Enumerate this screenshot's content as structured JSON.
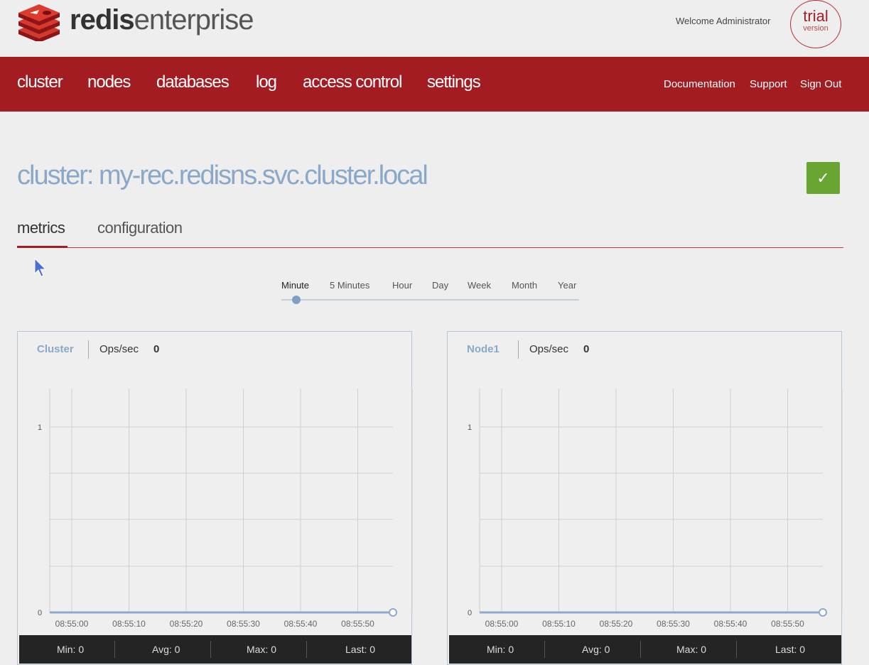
{
  "brand": {
    "bold": "redis",
    "light": "enterprise"
  },
  "header": {
    "welcome": "Welcome Administrator",
    "trial": "trial",
    "trial_sub": "version"
  },
  "nav": {
    "items": [
      "cluster",
      "nodes",
      "databases",
      "log",
      "access control",
      "settings"
    ],
    "right": [
      "Documentation",
      "Support",
      "Sign Out"
    ]
  },
  "page": {
    "title": "cluster: my-rec.redisns.svc.cluster.local",
    "status_icon": "check-icon"
  },
  "tabs": [
    "metrics",
    "configuration"
  ],
  "range": {
    "options": [
      "Minute",
      "5 Minutes",
      "Hour",
      "Day",
      "Week",
      "Month",
      "Year"
    ],
    "selected": "Minute"
  },
  "colors": {
    "brand_red": "#a31c22",
    "accent_blue": "#8aa8c8",
    "ok_green": "#6aa534"
  },
  "chart_data": [
    {
      "type": "line",
      "title": "Cluster",
      "metric": "Ops/sec",
      "current": "0",
      "x": [
        "08:55:00",
        "08:55:10",
        "08:55:20",
        "08:55:30",
        "08:55:40",
        "08:55:50"
      ],
      "yticks": [
        "0",
        "1"
      ],
      "ylim": [
        0,
        1
      ],
      "series": [
        {
          "values": [
            0,
            0,
            0,
            0,
            0,
            0,
            0
          ]
        }
      ],
      "stats": [
        {
          "label": "Min:",
          "value": "0"
        },
        {
          "label": "Avg:",
          "value": "0"
        },
        {
          "label": "Max:",
          "value": "0"
        },
        {
          "label": "Last:",
          "value": "0"
        }
      ]
    },
    {
      "type": "line",
      "title": "Node1",
      "metric": "Ops/sec",
      "current": "0",
      "x": [
        "08:55:00",
        "08:55:10",
        "08:55:20",
        "08:55:30",
        "08:55:40",
        "08:55:50"
      ],
      "yticks": [
        "0",
        "1"
      ],
      "ylim": [
        0,
        1
      ],
      "series": [
        {
          "values": [
            0,
            0,
            0,
            0,
            0,
            0,
            0
          ]
        }
      ],
      "stats": [
        {
          "label": "Min:",
          "value": "0"
        },
        {
          "label": "Avg:",
          "value": "0"
        },
        {
          "label": "Max:",
          "value": "0"
        },
        {
          "label": "Last:",
          "value": "0"
        }
      ]
    }
  ]
}
